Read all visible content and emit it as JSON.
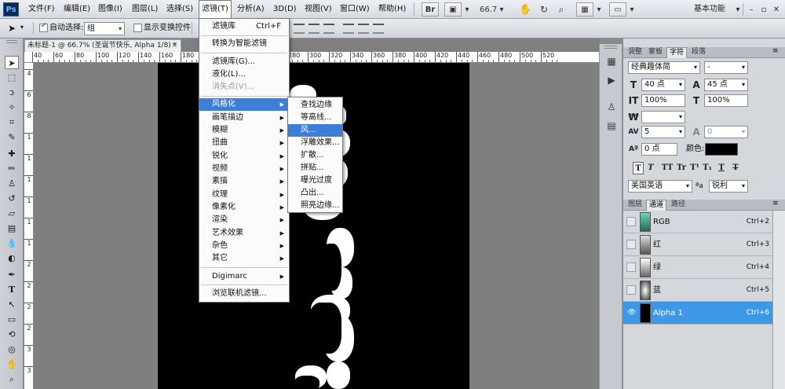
{
  "menubar": {
    "logo": "Ps",
    "items": [
      "文件(F)",
      "编辑(E)",
      "图像(I)",
      "图层(L)",
      "选择(S)",
      "滤镜(T)",
      "分析(A)",
      "3D(D)",
      "视图(V)",
      "窗口(W)",
      "帮助(H)"
    ],
    "active_item": "滤镜(T)",
    "br_label": "Br",
    "zoom": "66.7",
    "workspace": "基本功能"
  },
  "options": {
    "auto_select_label": "自动选择:",
    "auto_select_checked": true,
    "auto_select_value": "组",
    "show_transform_label": "显示变换控件",
    "show_transform_checked": false
  },
  "document": {
    "tab_title": "未标题-1 @ 66.7% (圣诞节快乐, Alpha 1/8) *",
    "close_glyph": "×",
    "ruler_h": [
      "40",
      "60",
      "80",
      "100",
      "120",
      "140",
      "160",
      "180",
      "200",
      "220",
      "240",
      "260",
      "280",
      "300",
      "320",
      "340",
      "360",
      "380",
      "400",
      "420",
      "440",
      "460",
      "480",
      "500",
      "520"
    ],
    "ruler_v": [
      "4",
      "6",
      "8",
      "1",
      "1",
      "1",
      "1",
      "1",
      "1",
      "2",
      "2",
      "2",
      "2",
      "3",
      "3"
    ]
  },
  "filter_menu": {
    "items": [
      {
        "label": "滤镜库",
        "shortcut": "Ctrl+F"
      },
      {
        "label": "转换为智能滤镜"
      },
      {
        "label": "滤镜库(G)..."
      },
      {
        "label": "液化(L)..."
      },
      {
        "label": "消失点(V)...",
        "disabled": true
      },
      {
        "label": "风格化",
        "submenu": true,
        "highlighted": true
      },
      {
        "label": "画笔描边",
        "submenu": true
      },
      {
        "label": "模糊",
        "submenu": true
      },
      {
        "label": "扭曲",
        "submenu": true
      },
      {
        "label": "锐化",
        "submenu": true
      },
      {
        "label": "视频",
        "submenu": true
      },
      {
        "label": "素描",
        "submenu": true
      },
      {
        "label": "纹理",
        "submenu": true
      },
      {
        "label": "像素化",
        "submenu": true
      },
      {
        "label": "渲染",
        "submenu": true
      },
      {
        "label": "艺术效果",
        "submenu": true
      },
      {
        "label": "杂色",
        "submenu": true
      },
      {
        "label": "其它",
        "submenu": true
      },
      {
        "label": "Digimarc",
        "submenu": true
      },
      {
        "label": "浏览联机滤镜..."
      }
    ]
  },
  "stylize_submenu": {
    "items": [
      "查找边缘",
      "等高线...",
      "风...",
      "浮雕效果...",
      "扩散...",
      "拼贴...",
      "曝光过度",
      "凸出...",
      "照亮边缘..."
    ],
    "highlighted": "风..."
  },
  "character_panel": {
    "tabs": [
      "调整",
      "蒙板",
      "字符",
      "段落"
    ],
    "active_tab": "字符",
    "font_family": "经典趣体简",
    "font_style": "-",
    "font_size": "40 点",
    "leading": "45 点",
    "vertical_scale": "100%",
    "horizontal_scale": "100%",
    "kerning": "",
    "tracking": "5",
    "tracking_alt": "0",
    "baseline_shift": "0 点",
    "color_label": "颜色:",
    "color": "#000000",
    "format_buttons": [
      "T",
      "T",
      "TT",
      "Tr",
      "T¹",
      "T₁",
      "T",
      "T"
    ],
    "language": "美国英语",
    "aa_label": "ªa",
    "antialias": "锐利"
  },
  "channels_panel": {
    "tabs": [
      "图层",
      "通道",
      "路径"
    ],
    "active_tab": "通道",
    "rows": [
      {
        "name": "RGB",
        "shortcut": "Ctrl+2",
        "thumb_color": "#2f8a6e",
        "selected": false
      },
      {
        "name": "红",
        "shortcut": "Ctrl+3",
        "thumb_color": "#444444",
        "selected": false
      },
      {
        "name": "绿",
        "shortcut": "Ctrl+4",
        "thumb_color": "#444444",
        "selected": false
      },
      {
        "name": "蓝",
        "shortcut": "Ctrl+5",
        "thumb_color": "#444444",
        "selected": false
      },
      {
        "name": "Alpha 1",
        "shortcut": "Ctrl+6",
        "thumb_color": "#000000",
        "selected": true
      }
    ]
  }
}
